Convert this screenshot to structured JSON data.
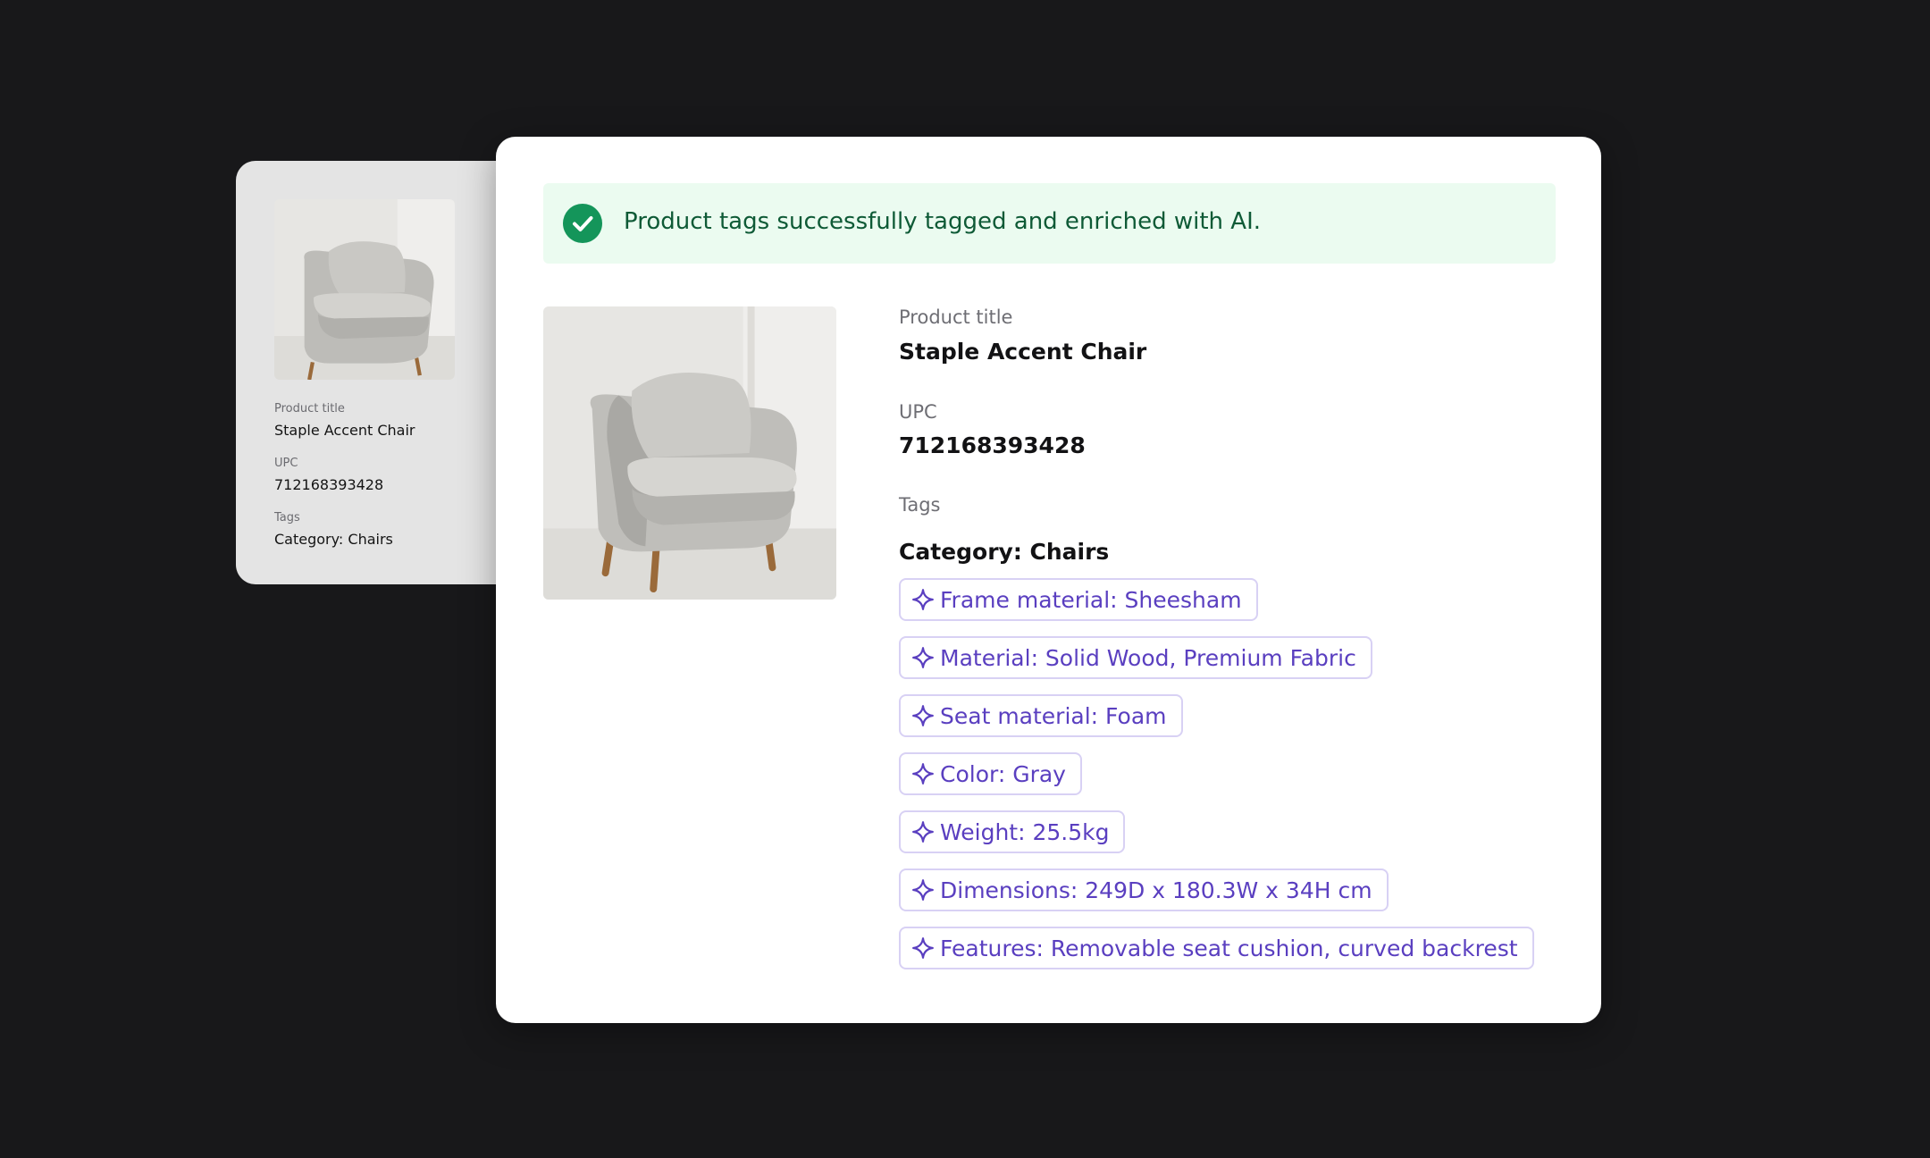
{
  "back_card": {
    "product_title_label": "Product title",
    "product_title": "Staple Accent Chair",
    "upc_label": "UPC",
    "upc": "712168393428",
    "tags_label": "Tags",
    "category": "Category: Chairs"
  },
  "front_card": {
    "banner_text": "Product tags successfully tagged and enriched with AI.",
    "product_title_label": "Product title",
    "product_title": "Staple Accent Chair",
    "upc_label": "UPC",
    "upc": "712168393428",
    "tags_label": "Tags",
    "category": "Category: Chairs",
    "tags": [
      "Frame material: Sheesham",
      "Material: Solid Wood, Premium Fabric",
      "Seat material: Foam",
      "Color: Gray",
      "Weight: 25.5kg",
      "Dimensions: 249D x 180.3W x 34H cm",
      "Features: Removable seat cushion, curved backrest"
    ]
  },
  "colors": {
    "background": "#18181a",
    "success_green": "#14955a",
    "banner_bg": "#ebfbf0",
    "ai_tag_purple": "#5a3fc0",
    "ai_tag_border": "#d8d1f4"
  },
  "icons": {
    "banner": "check-circle-icon",
    "tag": "sparkle-icon"
  }
}
